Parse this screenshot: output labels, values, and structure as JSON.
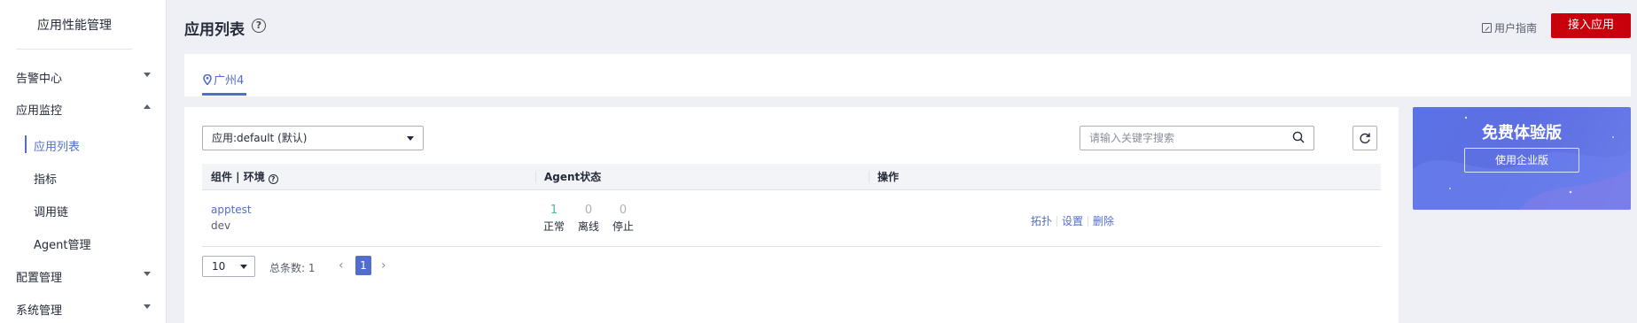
{
  "sidebar": {
    "title": "应用性能管理",
    "groups": [
      {
        "label": "告警中心",
        "expanded": false
      },
      {
        "label": "应用监控",
        "expanded": true,
        "items": [
          "应用列表",
          "指标",
          "调用链",
          "Agent管理"
        ]
      },
      {
        "label": "配置管理",
        "expanded": false
      },
      {
        "label": "系统管理",
        "expanded": false
      }
    ]
  },
  "header": {
    "title": "应用列表",
    "help_glyph": "?",
    "guide_label": "用户指南",
    "primary_button": "接入应用"
  },
  "region": {
    "tab": "广州4"
  },
  "filter": {
    "app_select_value": "应用:default (默认)",
    "search_placeholder": "请输入关键字搜索"
  },
  "table": {
    "columns": [
      "组件 | 环境",
      "Agent状态",
      "操作"
    ],
    "rows": [
      {
        "name": "apptest",
        "env": "dev",
        "status": [
          {
            "count": "1",
            "label": "正常"
          },
          {
            "count": "0",
            "label": "离线"
          },
          {
            "count": "0",
            "label": "停止"
          }
        ],
        "actions": [
          "拓扑",
          "设置",
          "删除"
        ]
      }
    ]
  },
  "pager": {
    "page_size": "10",
    "total_label": "总条数: 1",
    "current_page": "1",
    "prev_glyph": "‹",
    "next_glyph": "›"
  },
  "promo": {
    "title": "免费体验版",
    "button": "使用企业版"
  },
  "colors": {
    "accent": "#526ecc",
    "primary_button": "#c7000b",
    "status_ok": "#50b4a8",
    "promo_bg": "#5d6fe2"
  }
}
